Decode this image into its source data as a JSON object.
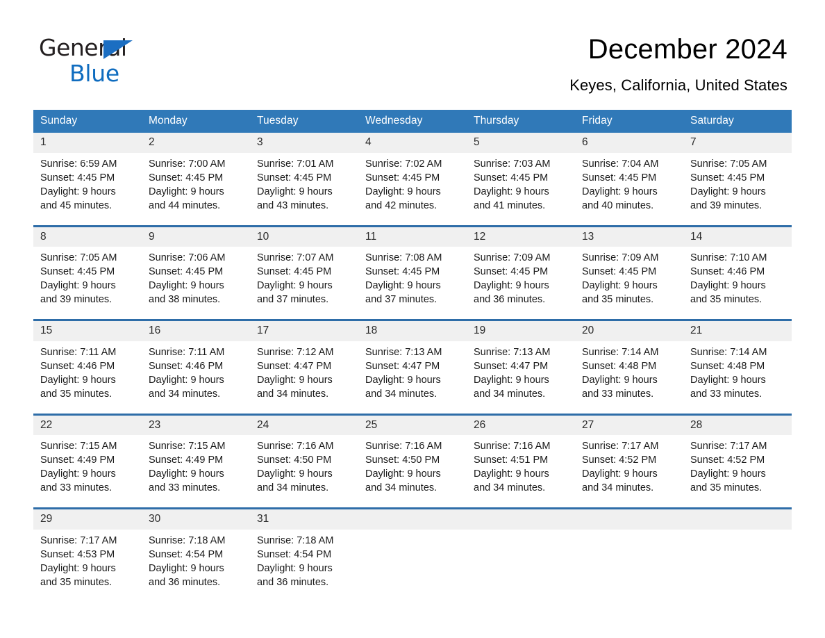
{
  "brand": {
    "line1": "General",
    "line2": "Blue",
    "triangle_color": "#1b6ec2"
  },
  "header": {
    "month_title": "December 2024",
    "location": "Keyes, California, United States"
  },
  "theme": {
    "header_blue": "#3079b8",
    "row_rule_blue": "#2e6da8",
    "daynum_strip": "#f0f0f0"
  },
  "weekdays": [
    "Sunday",
    "Monday",
    "Tuesday",
    "Wednesday",
    "Thursday",
    "Friday",
    "Saturday"
  ],
  "weeks": [
    [
      {
        "day": "1",
        "sunrise": "Sunrise: 6:59 AM",
        "sunset": "Sunset: 4:45 PM",
        "daylight1": "Daylight: 9 hours",
        "daylight2": "and 45 minutes."
      },
      {
        "day": "2",
        "sunrise": "Sunrise: 7:00 AM",
        "sunset": "Sunset: 4:45 PM",
        "daylight1": "Daylight: 9 hours",
        "daylight2": "and 44 minutes."
      },
      {
        "day": "3",
        "sunrise": "Sunrise: 7:01 AM",
        "sunset": "Sunset: 4:45 PM",
        "daylight1": "Daylight: 9 hours",
        "daylight2": "and 43 minutes."
      },
      {
        "day": "4",
        "sunrise": "Sunrise: 7:02 AM",
        "sunset": "Sunset: 4:45 PM",
        "daylight1": "Daylight: 9 hours",
        "daylight2": "and 42 minutes."
      },
      {
        "day": "5",
        "sunrise": "Sunrise: 7:03 AM",
        "sunset": "Sunset: 4:45 PM",
        "daylight1": "Daylight: 9 hours",
        "daylight2": "and 41 minutes."
      },
      {
        "day": "6",
        "sunrise": "Sunrise: 7:04 AM",
        "sunset": "Sunset: 4:45 PM",
        "daylight1": "Daylight: 9 hours",
        "daylight2": "and 40 minutes."
      },
      {
        "day": "7",
        "sunrise": "Sunrise: 7:05 AM",
        "sunset": "Sunset: 4:45 PM",
        "daylight1": "Daylight: 9 hours",
        "daylight2": "and 39 minutes."
      }
    ],
    [
      {
        "day": "8",
        "sunrise": "Sunrise: 7:05 AM",
        "sunset": "Sunset: 4:45 PM",
        "daylight1": "Daylight: 9 hours",
        "daylight2": "and 39 minutes."
      },
      {
        "day": "9",
        "sunrise": "Sunrise: 7:06 AM",
        "sunset": "Sunset: 4:45 PM",
        "daylight1": "Daylight: 9 hours",
        "daylight2": "and 38 minutes."
      },
      {
        "day": "10",
        "sunrise": "Sunrise: 7:07 AM",
        "sunset": "Sunset: 4:45 PM",
        "daylight1": "Daylight: 9 hours",
        "daylight2": "and 37 minutes."
      },
      {
        "day": "11",
        "sunrise": "Sunrise: 7:08 AM",
        "sunset": "Sunset: 4:45 PM",
        "daylight1": "Daylight: 9 hours",
        "daylight2": "and 37 minutes."
      },
      {
        "day": "12",
        "sunrise": "Sunrise: 7:09 AM",
        "sunset": "Sunset: 4:45 PM",
        "daylight1": "Daylight: 9 hours",
        "daylight2": "and 36 minutes."
      },
      {
        "day": "13",
        "sunrise": "Sunrise: 7:09 AM",
        "sunset": "Sunset: 4:45 PM",
        "daylight1": "Daylight: 9 hours",
        "daylight2": "and 35 minutes."
      },
      {
        "day": "14",
        "sunrise": "Sunrise: 7:10 AM",
        "sunset": "Sunset: 4:46 PM",
        "daylight1": "Daylight: 9 hours",
        "daylight2": "and 35 minutes."
      }
    ],
    [
      {
        "day": "15",
        "sunrise": "Sunrise: 7:11 AM",
        "sunset": "Sunset: 4:46 PM",
        "daylight1": "Daylight: 9 hours",
        "daylight2": "and 35 minutes."
      },
      {
        "day": "16",
        "sunrise": "Sunrise: 7:11 AM",
        "sunset": "Sunset: 4:46 PM",
        "daylight1": "Daylight: 9 hours",
        "daylight2": "and 34 minutes."
      },
      {
        "day": "17",
        "sunrise": "Sunrise: 7:12 AM",
        "sunset": "Sunset: 4:47 PM",
        "daylight1": "Daylight: 9 hours",
        "daylight2": "and 34 minutes."
      },
      {
        "day": "18",
        "sunrise": "Sunrise: 7:13 AM",
        "sunset": "Sunset: 4:47 PM",
        "daylight1": "Daylight: 9 hours",
        "daylight2": "and 34 minutes."
      },
      {
        "day": "19",
        "sunrise": "Sunrise: 7:13 AM",
        "sunset": "Sunset: 4:47 PM",
        "daylight1": "Daylight: 9 hours",
        "daylight2": "and 34 minutes."
      },
      {
        "day": "20",
        "sunrise": "Sunrise: 7:14 AM",
        "sunset": "Sunset: 4:48 PM",
        "daylight1": "Daylight: 9 hours",
        "daylight2": "and 33 minutes."
      },
      {
        "day": "21",
        "sunrise": "Sunrise: 7:14 AM",
        "sunset": "Sunset: 4:48 PM",
        "daylight1": "Daylight: 9 hours",
        "daylight2": "and 33 minutes."
      }
    ],
    [
      {
        "day": "22",
        "sunrise": "Sunrise: 7:15 AM",
        "sunset": "Sunset: 4:49 PM",
        "daylight1": "Daylight: 9 hours",
        "daylight2": "and 33 minutes."
      },
      {
        "day": "23",
        "sunrise": "Sunrise: 7:15 AM",
        "sunset": "Sunset: 4:49 PM",
        "daylight1": "Daylight: 9 hours",
        "daylight2": "and 33 minutes."
      },
      {
        "day": "24",
        "sunrise": "Sunrise: 7:16 AM",
        "sunset": "Sunset: 4:50 PM",
        "daylight1": "Daylight: 9 hours",
        "daylight2": "and 34 minutes."
      },
      {
        "day": "25",
        "sunrise": "Sunrise: 7:16 AM",
        "sunset": "Sunset: 4:50 PM",
        "daylight1": "Daylight: 9 hours",
        "daylight2": "and 34 minutes."
      },
      {
        "day": "26",
        "sunrise": "Sunrise: 7:16 AM",
        "sunset": "Sunset: 4:51 PM",
        "daylight1": "Daylight: 9 hours",
        "daylight2": "and 34 minutes."
      },
      {
        "day": "27",
        "sunrise": "Sunrise: 7:17 AM",
        "sunset": "Sunset: 4:52 PM",
        "daylight1": "Daylight: 9 hours",
        "daylight2": "and 34 minutes."
      },
      {
        "day": "28",
        "sunrise": "Sunrise: 7:17 AM",
        "sunset": "Sunset: 4:52 PM",
        "daylight1": "Daylight: 9 hours",
        "daylight2": "and 35 minutes."
      }
    ],
    [
      {
        "day": "29",
        "sunrise": "Sunrise: 7:17 AM",
        "sunset": "Sunset: 4:53 PM",
        "daylight1": "Daylight: 9 hours",
        "daylight2": "and 35 minutes."
      },
      {
        "day": "30",
        "sunrise": "Sunrise: 7:18 AM",
        "sunset": "Sunset: 4:54 PM",
        "daylight1": "Daylight: 9 hours",
        "daylight2": "and 36 minutes."
      },
      {
        "day": "31",
        "sunrise": "Sunrise: 7:18 AM",
        "sunset": "Sunset: 4:54 PM",
        "daylight1": "Daylight: 9 hours",
        "daylight2": "and 36 minutes."
      },
      {
        "day": "",
        "sunrise": "",
        "sunset": "",
        "daylight1": "",
        "daylight2": ""
      },
      {
        "day": "",
        "sunrise": "",
        "sunset": "",
        "daylight1": "",
        "daylight2": ""
      },
      {
        "day": "",
        "sunrise": "",
        "sunset": "",
        "daylight1": "",
        "daylight2": ""
      },
      {
        "day": "",
        "sunrise": "",
        "sunset": "",
        "daylight1": "",
        "daylight2": ""
      }
    ]
  ]
}
